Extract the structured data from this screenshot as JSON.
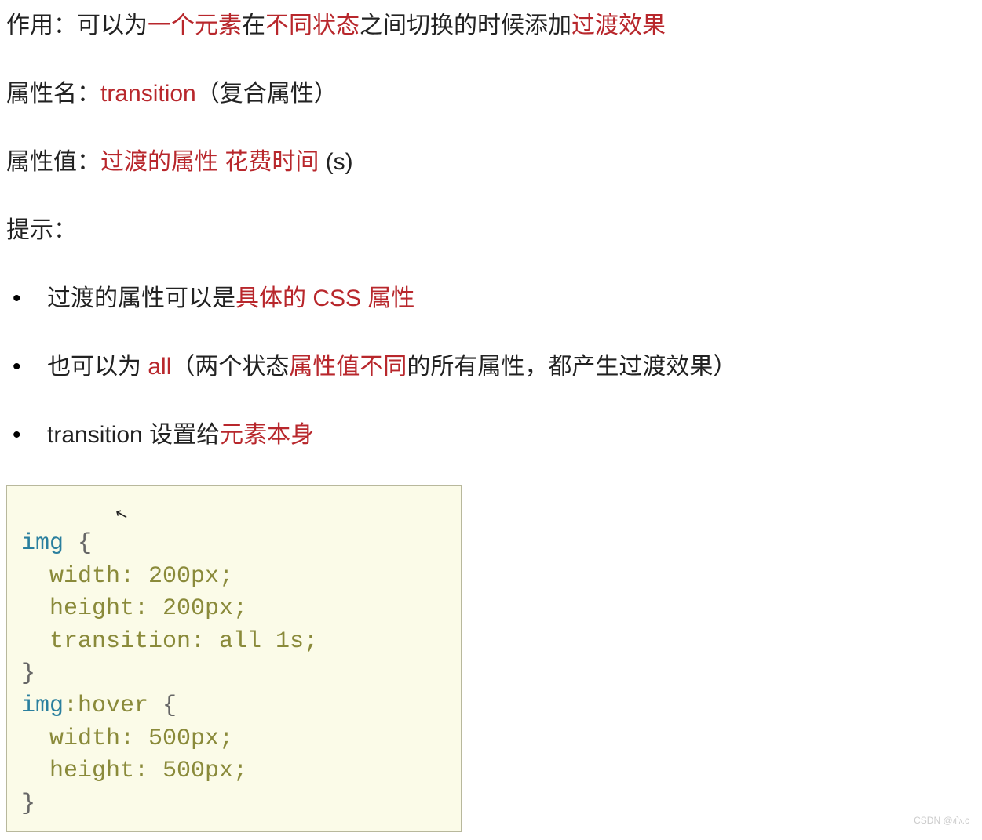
{
  "line1": {
    "p1": "作用：可以为",
    "r1": "一个元素",
    "p2": "在",
    "r2": "不同状态",
    "p3": "之间切换的时候添加",
    "r3": "过渡效果"
  },
  "line2": {
    "p1": "属性名：",
    "r1": "transition",
    "p2": "（复合属性）"
  },
  "line3": {
    "p1": "属性值：",
    "r1": "过渡的属性",
    "sp": "  ",
    "r2": "花费时间",
    "p2": " (s)"
  },
  "line4": "提示：",
  "bullets": [
    {
      "p1": "过渡的属性可以是",
      "r1": "具体的 CSS 属性"
    },
    {
      "p1": "也可以为 ",
      "r1": "all",
      "p2": "（两个状态",
      "r2": "属性值不同",
      "p3": "的所有属性，都产生过渡效果）"
    },
    {
      "p1": "transition 设置给",
      "r1": "元素本身"
    }
  ],
  "code": {
    "l1_sel": "img",
    "l1_brace": " {",
    "l2": "  width: 200px;",
    "l3": "  height: 200px;",
    "l4": "  transition: all 1s;",
    "l5": "}",
    "l6_sel": "img",
    "l6_pseudo": ":hover",
    "l6_brace": " {",
    "l7": "  width: 500px;",
    "l8": "  height: 500px;",
    "l9": "}"
  },
  "watermark": "CSDN @心.c"
}
